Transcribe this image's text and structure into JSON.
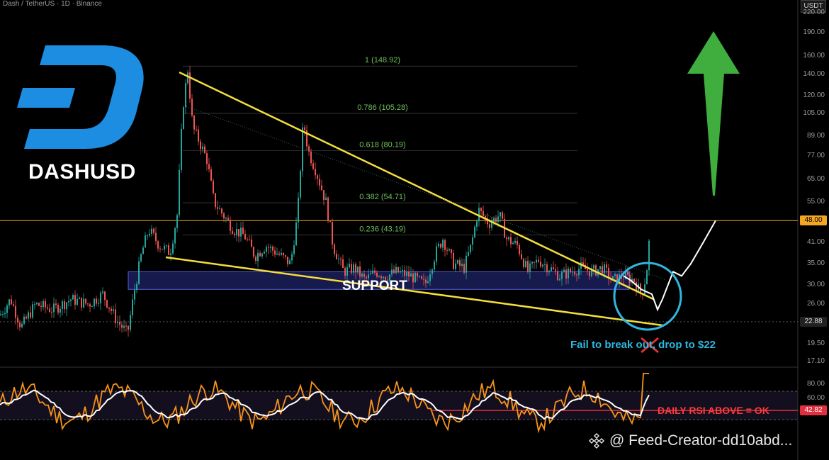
{
  "header": {
    "title": "Dash / TetherUS · 1D · Binance"
  },
  "overlay": {
    "ticker": "DASHUSD",
    "support_label": "SUPPORT",
    "fail_note": "Fail to break out, drop to $22",
    "rsi_note": "DAILY RSI ABOVE = OK",
    "watermark": "@ Feed-Creator-dd10abd..."
  },
  "axis": {
    "unit": "USDT",
    "price_ticks": [
      "220.00",
      "190.00",
      "160.00",
      "140.00",
      "120.00",
      "105.00",
      "89.00",
      "77.00",
      "65.00",
      "55.00",
      "41.00",
      "35.00",
      "30.00",
      "26.00",
      "19.50",
      "17.10"
    ],
    "rsi_ticks": [
      "80.00",
      "60.00"
    ],
    "current_price": "48.00",
    "target_price": "22.88",
    "rsi_value": "42.82"
  },
  "colors": {
    "up": "#26a69a",
    "down": "#ef5350",
    "trendline": "#f5de3c",
    "fib": "#6fbf5a",
    "support_zone": "#2a2f8a",
    "price_line": "#f5a623",
    "circle": "#2fb7e0",
    "arrow": "#3fae3f",
    "rsi": "#f7931a",
    "rsi_ma": "#ffffff"
  },
  "chart_data": {
    "type": "candlestick",
    "title": "Dash / TetherUS · 1D · Binance",
    "y_scale": "log",
    "ylim": [
      17.1,
      220
    ],
    "fib_levels": [
      {
        "label": "1 (148.92)",
        "value": 148.92
      },
      {
        "label": "0.786 (105.28)",
        "value": 105.28
      },
      {
        "label": "0.618 (80.19)",
        "value": 80.19
      },
      {
        "label": "0.382 (54.71)",
        "value": 54.71
      },
      {
        "label": "0.236 (43.19)",
        "value": 43.19
      }
    ],
    "support_zone": {
      "low": 29,
      "high": 33
    },
    "price_waypoints": [
      [
        0,
        24
      ],
      [
        15,
        27
      ],
      [
        30,
        22
      ],
      [
        50,
        26
      ],
      [
        75,
        25
      ],
      [
        100,
        27
      ],
      [
        125,
        26
      ],
      [
        145,
        28
      ],
      [
        165,
        23
      ],
      [
        180,
        21
      ],
      [
        190,
        29
      ],
      [
        200,
        38
      ],
      [
        210,
        45
      ],
      [
        225,
        40
      ],
      [
        240,
        38
      ],
      [
        250,
        50
      ],
      [
        258,
        110
      ],
      [
        265,
        145
      ],
      [
        272,
        95
      ],
      [
        282,
        85
      ],
      [
        292,
        75
      ],
      [
        302,
        55
      ],
      [
        315,
        50
      ],
      [
        330,
        45
      ],
      [
        345,
        43
      ],
      [
        360,
        37
      ],
      [
        375,
        40
      ],
      [
        390,
        38
      ],
      [
        410,
        35
      ],
      [
        420,
        50
      ],
      [
        428,
        100
      ],
      [
        435,
        80
      ],
      [
        445,
        70
      ],
      [
        460,
        55
      ],
      [
        470,
        40
      ],
      [
        485,
        33
      ],
      [
        500,
        34
      ],
      [
        515,
        31
      ],
      [
        530,
        33
      ],
      [
        545,
        32
      ],
      [
        560,
        33
      ],
      [
        580,
        32
      ],
      [
        600,
        30
      ],
      [
        615,
        38
      ],
      [
        625,
        42
      ],
      [
        640,
        35
      ],
      [
        655,
        34
      ],
      [
        665,
        40
      ],
      [
        675,
        52
      ],
      [
        690,
        47
      ],
      [
        705,
        50
      ],
      [
        715,
        42
      ],
      [
        730,
        40
      ],
      [
        745,
        33
      ],
      [
        760,
        36
      ],
      [
        775,
        34
      ],
      [
        790,
        32
      ],
      [
        805,
        33
      ],
      [
        820,
        34
      ],
      [
        835,
        33
      ],
      [
        850,
        34
      ],
      [
        865,
        31
      ],
      [
        880,
        32
      ],
      [
        895,
        31
      ],
      [
        905,
        28
      ],
      [
        912,
        32
      ],
      [
        918,
        46
      ]
    ],
    "projection": [
      [
        880,
        32
      ],
      [
        890,
        31
      ],
      [
        905,
        29
      ],
      [
        920,
        28
      ],
      [
        928,
        25
      ],
      [
        935,
        27
      ],
      [
        950,
        33
      ],
      [
        962,
        32
      ],
      [
        975,
        35
      ],
      [
        990,
        40
      ],
      [
        1010,
        48
      ]
    ],
    "rsi_ylim": [
      0,
      100
    ],
    "rsi_levels": [
      70,
      30
    ],
    "rsi_current": 42.82
  }
}
